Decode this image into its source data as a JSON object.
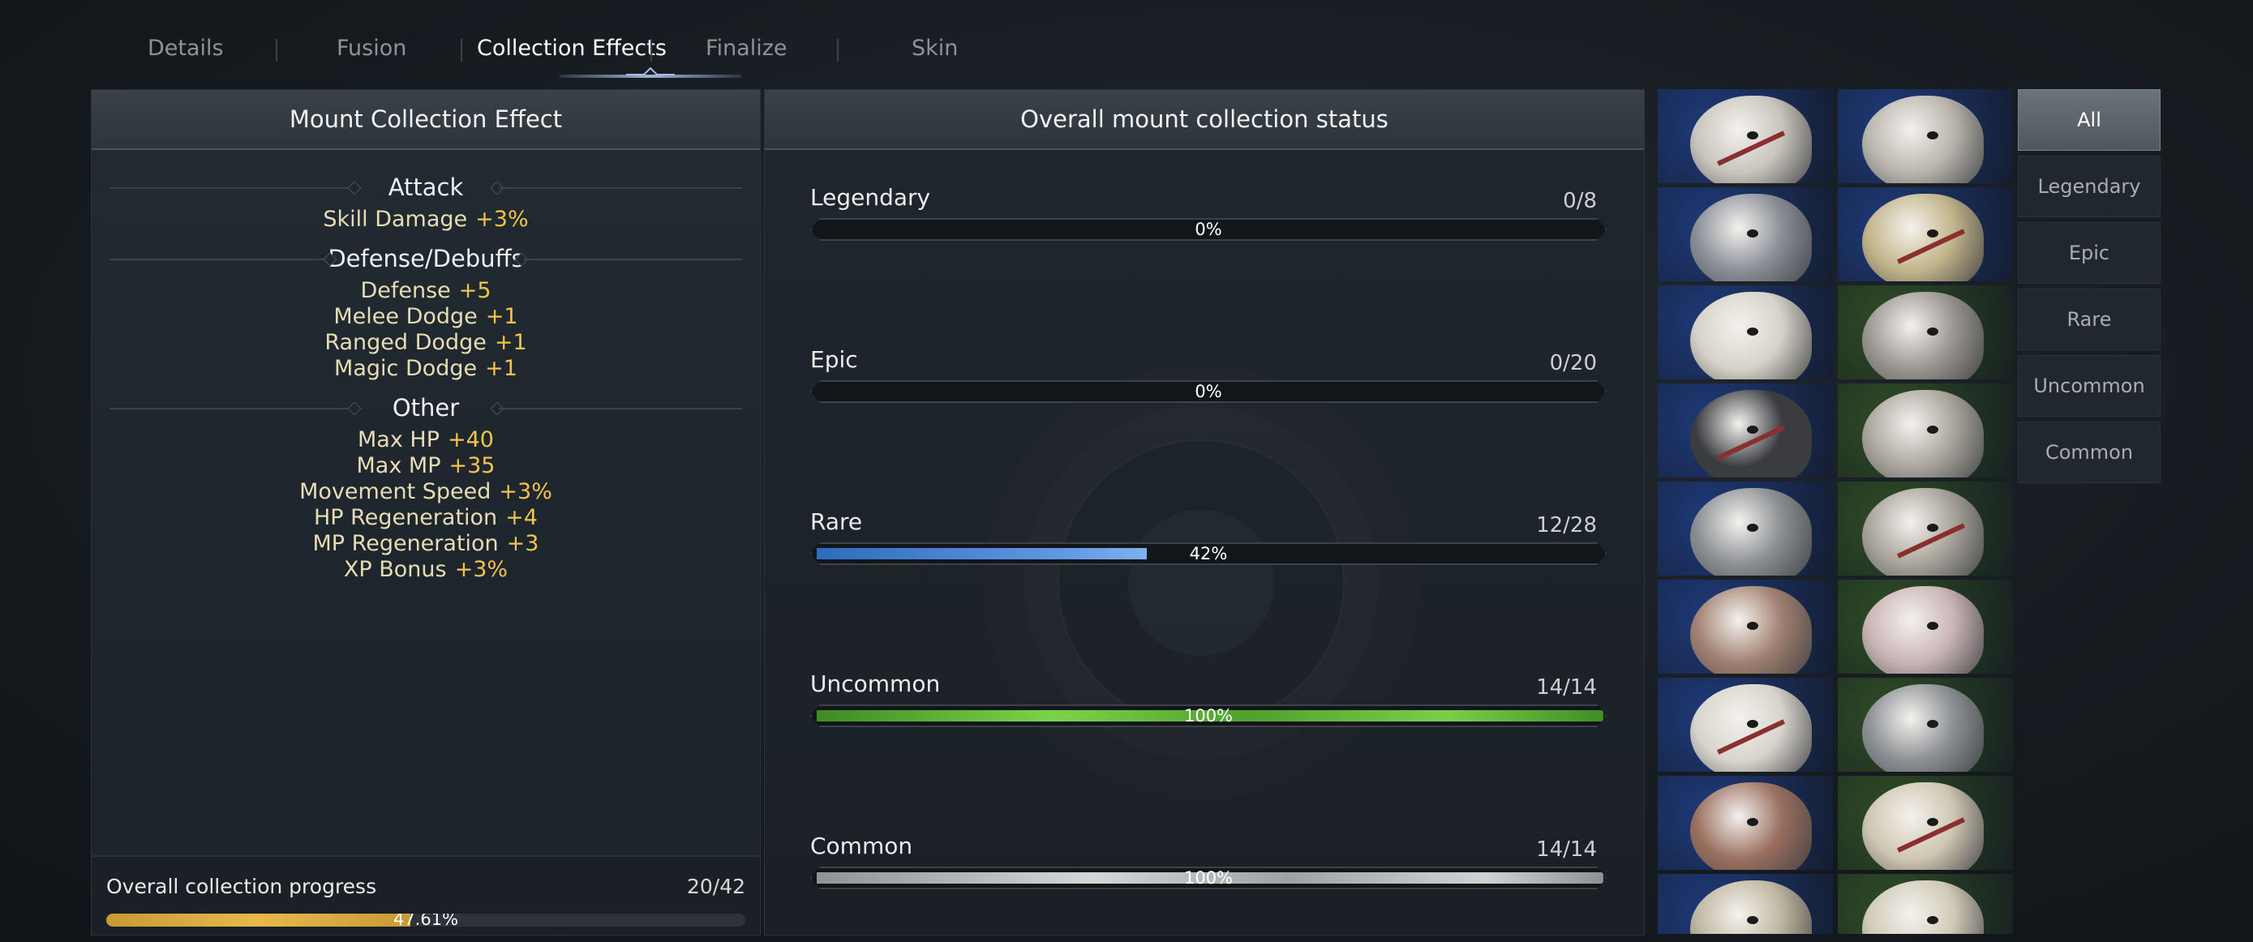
{
  "tabs": [
    {
      "label": "Details"
    },
    {
      "label": "Fusion"
    },
    {
      "label": "Collection Effects",
      "active": true
    },
    {
      "label": "Finalize"
    },
    {
      "label": "Skin"
    }
  ],
  "left_panel": {
    "title": "Mount Collection Effect",
    "categories": [
      {
        "name": "Attack",
        "effects": [
          {
            "stat": "Skill Damage",
            "value": "+3%"
          }
        ]
      },
      {
        "name": "Defense/Debuffs",
        "effects": [
          {
            "stat": "Defense",
            "value": "+5"
          },
          {
            "stat": "Melee Dodge",
            "value": "+1"
          },
          {
            "stat": "Ranged Dodge",
            "value": "+1"
          },
          {
            "stat": "Magic Dodge",
            "value": "+1"
          }
        ]
      },
      {
        "name": "Other",
        "effects": [
          {
            "stat": "Max HP",
            "value": "+40"
          },
          {
            "stat": "Max MP",
            "value": "+35"
          },
          {
            "stat": "Movement Speed",
            "value": "+3%"
          },
          {
            "stat": "HP Regeneration",
            "value": "+4"
          },
          {
            "stat": "MP Regeneration",
            "value": "+3"
          },
          {
            "stat": "XP Bonus",
            "value": "+3%"
          }
        ]
      }
    ],
    "overall": {
      "label": "Overall collection progress",
      "count": "20/42",
      "percent_text": "47.61%",
      "fraction": 0.4761
    }
  },
  "mid_panel": {
    "title": "Overall mount collection status",
    "rarities": [
      {
        "name": "Legendary",
        "count": "0/8",
        "percent_text": "0%",
        "fraction": 0,
        "fill": "none"
      },
      {
        "name": "Epic",
        "count": "0/20",
        "percent_text": "0%",
        "fraction": 0,
        "fill": "none"
      },
      {
        "name": "Rare",
        "count": "12/28",
        "percent_text": "42%",
        "fraction": 0.42,
        "fill": "rare"
      },
      {
        "name": "Uncommon",
        "count": "14/14",
        "percent_text": "100%",
        "fraction": 1.0,
        "fill": "uncommon"
      },
      {
        "name": "Common",
        "count": "14/14",
        "percent_text": "100%",
        "fraction": 1.0,
        "fill": "common"
      }
    ]
  },
  "mount_grid": {
    "tiles": [
      {
        "bg": "#1e3a7a",
        "creature": "#c9c5bd"
      },
      {
        "bg": "#1e3a7a",
        "creature": "#b9b5ad"
      },
      {
        "bg": "#1e3a7a",
        "creature": "#8a8e96"
      },
      {
        "bg": "#1e3a7a",
        "creature": "#c2b48a"
      },
      {
        "bg": "#1e3a7a",
        "creature": "#d6d2c8"
      },
      {
        "bg": "#2f4d24",
        "creature": "#9a9690"
      },
      {
        "bg": "#1e3a7a",
        "creature": "#3a3c40"
      },
      {
        "bg": "#2f4d24",
        "creature": "#aaa69d"
      },
      {
        "bg": "#1e3a7a",
        "creature": "#8b8e92"
      },
      {
        "bg": "#2f4d24",
        "creature": "#a7a39a"
      },
      {
        "bg": "#1e3a7a",
        "creature": "#a08070"
      },
      {
        "bg": "#2f4d24",
        "creature": "#c9b4b4"
      },
      {
        "bg": "#1e3a7a",
        "creature": "#d8d4cc"
      },
      {
        "bg": "#2f4d24",
        "creature": "#8c8f93"
      },
      {
        "bg": "#1e3a7a",
        "creature": "#9a6f5e"
      },
      {
        "bg": "#2f4d24",
        "creature": "#cfc6b2"
      },
      {
        "bg": "#1e3a7a",
        "creature": "#bfb6a0"
      },
      {
        "bg": "#2f4d24",
        "creature": "#d0cab8"
      }
    ]
  },
  "filters": [
    {
      "label": "All",
      "active": true
    },
    {
      "label": "Legendary"
    },
    {
      "label": "Epic"
    },
    {
      "label": "Rare"
    },
    {
      "label": "Uncommon"
    },
    {
      "label": "Common"
    }
  ]
}
